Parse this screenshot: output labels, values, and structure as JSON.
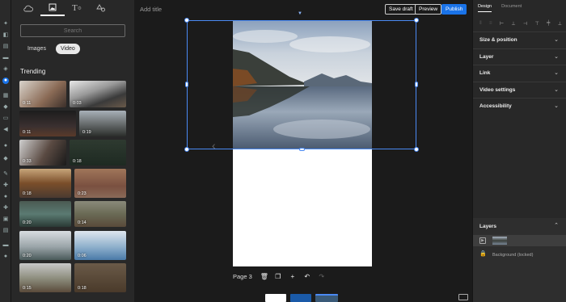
{
  "header": {
    "title_placeholder": "Add title",
    "save_draft": "Save draft",
    "preview": "Preview",
    "publish": "Publish",
    "accent": "#1a73e8"
  },
  "library": {
    "tabs": [
      "cloud-upload-icon",
      "image-icon",
      "text-icon",
      "shapes-icon"
    ],
    "search_placeholder": "Search",
    "media_types": [
      "Images",
      "Video"
    ],
    "selected_media_type": "Video",
    "section_title": "Trending",
    "videos": [
      {
        "duration": "0:11"
      },
      {
        "duration": "0:03"
      },
      {
        "duration": "0:11"
      },
      {
        "duration": "0:19"
      },
      {
        "duration": "0:33"
      },
      {
        "duration": "0:18"
      },
      {
        "duration": "0:18"
      },
      {
        "duration": "0:23"
      },
      {
        "duration": "0:20"
      },
      {
        "duration": "0:14"
      },
      {
        "duration": "0:20"
      },
      {
        "duration": "0:06"
      },
      {
        "duration": "0:15"
      },
      {
        "duration": "0:18"
      }
    ]
  },
  "canvas": {
    "page_label": "Page 3"
  },
  "properties": {
    "tabs": [
      "Design",
      "Document"
    ],
    "active_tab": "Design",
    "sections": [
      "Size & position",
      "Layer",
      "Link",
      "Video settings",
      "Accessibility"
    ],
    "layers_title": "Layers",
    "background_layer": "Background (locked)"
  }
}
